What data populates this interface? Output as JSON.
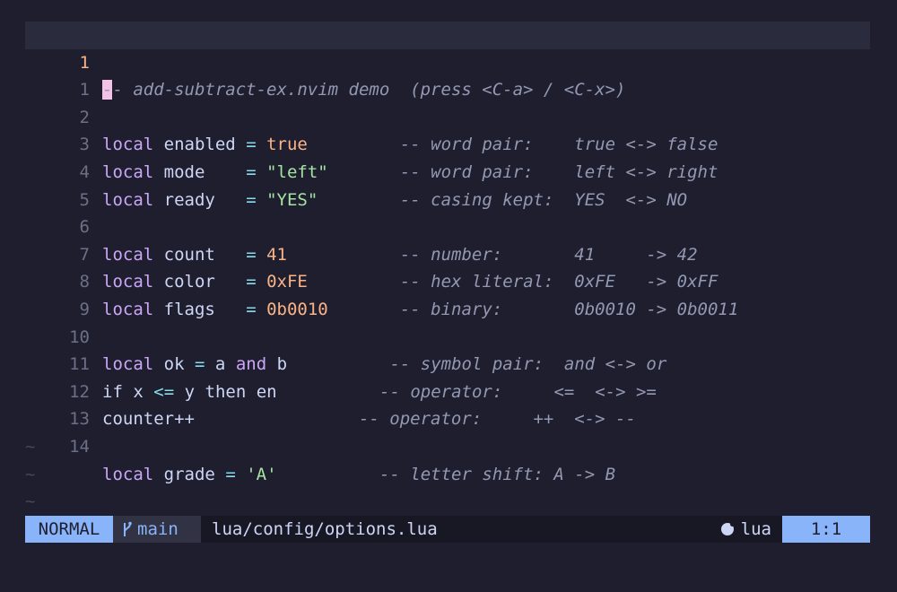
{
  "editor": {
    "lines": [
      {
        "num": "1",
        "cursor": "-",
        "rest": "- add-subtract-ex.nvim demo  (press <C-a> / <C-x>)"
      },
      {
        "num": "1"
      },
      {
        "num": "2",
        "kw": "local",
        "name": "enabled",
        "pad": " ",
        "op": "=",
        "value": "true",
        "comment": "-- word pair:    true <-> false"
      },
      {
        "num": "3",
        "kw": "local",
        "name": "mode",
        "pad": "    ",
        "op": "=",
        "value": "\"left\"",
        "comment": "-- word pair:    left <-> right"
      },
      {
        "num": "4",
        "kw": "local",
        "name": "ready",
        "pad": "   ",
        "op": "=",
        "value": "\"YES\"",
        "comment": "-- casing kept:  YES  <-> NO"
      },
      {
        "num": "5"
      },
      {
        "num": "6",
        "kw": "local",
        "name": "count",
        "pad": "   ",
        "op": "=",
        "value": "41",
        "comment": "-- number:       41     -> 42"
      },
      {
        "num": "7",
        "kw": "local",
        "name": "color",
        "pad": "   ",
        "op": "=",
        "value": "0xFE",
        "comment": "-- hex literal:  0xFE   -> 0xFF"
      },
      {
        "num": "8",
        "kw": "local",
        "name": "flags",
        "pad": "   ",
        "op": "=",
        "value": "0b0010",
        "comment": "-- binary:       0b0010 -> 0b0011"
      },
      {
        "num": "9"
      },
      {
        "num": "10",
        "kw": "local",
        "name": "ok",
        "op": "=",
        "a": "a",
        "and": "and",
        "b": "b",
        "comment": "-- symbol pair:  and <-> or"
      },
      {
        "num": "11",
        "if": "if",
        "x": "x",
        "op": "<=",
        "y": "y",
        "then": "then",
        "en": "en",
        "comment": "-- operator:     <=  <-> >="
      },
      {
        "num": "12",
        "text": "counter++",
        "comment": "-- operator:     ++  <-> --"
      },
      {
        "num": "13"
      },
      {
        "num": "14",
        "kw": "local",
        "name": "grade",
        "op": "=",
        "value": "'A'",
        "comment": "-- letter shift: A -> B"
      }
    ],
    "empty_marker": "~"
  },
  "statusline": {
    "mode": "NORMAL",
    "branch_icon": "git-branch-icon",
    "branch": "main",
    "file": "lua/config/options.lua",
    "filetype_icon": "lua-icon",
    "filetype": "lua",
    "position": "1:1"
  },
  "colors": {
    "background": "#1e1e2e",
    "keyword": "#cba6f7",
    "string": "#a6e3a1",
    "number": "#fab387",
    "operator": "#89dceb",
    "comment": "#9399b2",
    "mode_bg": "#89b4fa",
    "cursor": "#f5c2e7"
  }
}
